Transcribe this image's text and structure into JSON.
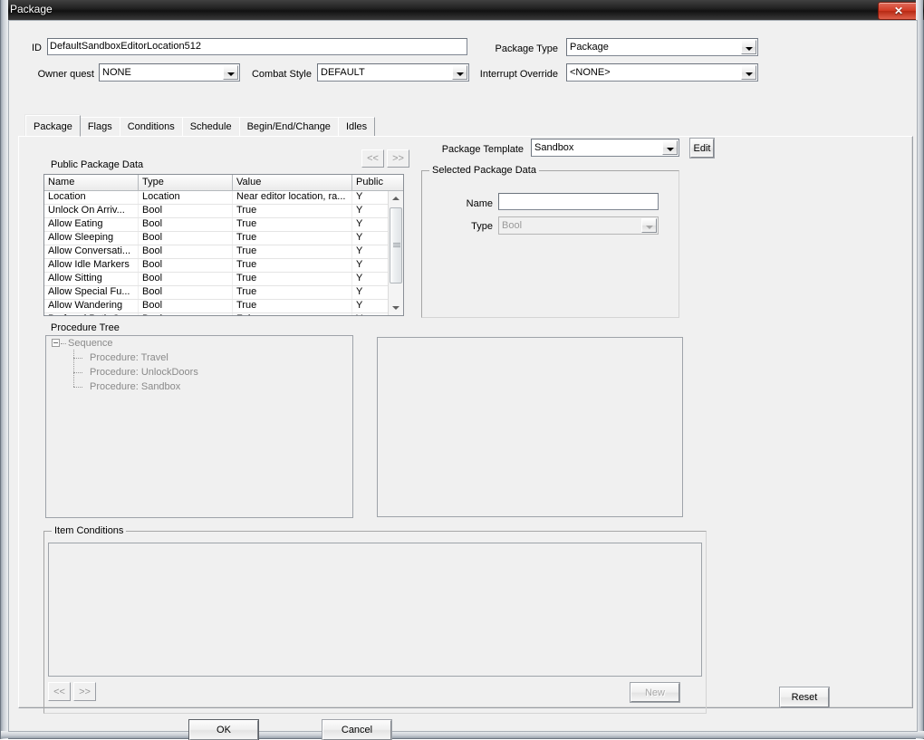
{
  "window": {
    "title": "Package",
    "close_label": "✕"
  },
  "header": {
    "id_label": "ID",
    "id_value": "DefaultSandboxEditorLocation512",
    "owner_quest_label": "Owner quest",
    "owner_quest_value": "NONE",
    "combat_style_label": "Combat Style",
    "combat_style_value": "DEFAULT",
    "package_type_label": "Package Type",
    "package_type_value": "Package",
    "interrupt_override_label": "Interrupt Override",
    "interrupt_override_value": "<NONE>"
  },
  "tabs": [
    {
      "label": "Package",
      "active": true
    },
    {
      "label": "Flags",
      "active": false
    },
    {
      "label": "Conditions",
      "active": false
    },
    {
      "label": "Schedule",
      "active": false
    },
    {
      "label": "Begin/End/Change",
      "active": false
    },
    {
      "label": "Idles",
      "active": false
    }
  ],
  "public_package_data": {
    "group_label": "Public Package Data",
    "prev_label": "<<",
    "next_label": ">>",
    "columns": [
      "Name",
      "Type",
      "Value",
      "Public"
    ],
    "rows": [
      {
        "name": "Location",
        "type": "Location",
        "value": "Near editor location, ra...",
        "public": "Y"
      },
      {
        "name": "Unlock On Arriv...",
        "type": "Bool",
        "value": "True",
        "public": "Y"
      },
      {
        "name": "Allow Eating",
        "type": "Bool",
        "value": "True",
        "public": "Y"
      },
      {
        "name": "Allow Sleeping",
        "type": "Bool",
        "value": "True",
        "public": "Y"
      },
      {
        "name": "Allow Conversati...",
        "type": "Bool",
        "value": "True",
        "public": "Y"
      },
      {
        "name": "Allow Idle Markers",
        "type": "Bool",
        "value": "True",
        "public": "Y"
      },
      {
        "name": "Allow Sitting",
        "type": "Bool",
        "value": "True",
        "public": "Y"
      },
      {
        "name": "Allow Special Fu...",
        "type": "Bool",
        "value": "True",
        "public": "Y"
      },
      {
        "name": "Allow Wandering",
        "type": "Bool",
        "value": "True",
        "public": "Y"
      },
      {
        "name": "Prefered Path O...",
        "type": "Bool",
        "value": "False",
        "public": "Y"
      }
    ]
  },
  "package_template": {
    "label": "Package Template",
    "value": "Sandbox",
    "edit_label": "Edit"
  },
  "selected_package_data": {
    "group_label": "Selected Package Data",
    "name_label": "Name",
    "name_value": "",
    "type_label": "Type",
    "type_value": "Bool"
  },
  "procedure_tree": {
    "group_label": "Procedure Tree",
    "root": "Sequence",
    "children": [
      "Procedure: Travel",
      "Procedure: UnlockDoors",
      "Procedure: Sandbox"
    ]
  },
  "item_conditions": {
    "group_label": "Item Conditions",
    "prev_label": "<<",
    "next_label": ">>",
    "new_label": "New"
  },
  "footer": {
    "reset_label": "Reset",
    "ok_label": "OK",
    "cancel_label": "Cancel"
  },
  "colors": {
    "window_bg": "#f0f0f0",
    "field_bg": "#ffffff",
    "close_button": "#d23b25",
    "disabled_text": "#a9a9a9",
    "tree_text": "#8a8a8a"
  }
}
